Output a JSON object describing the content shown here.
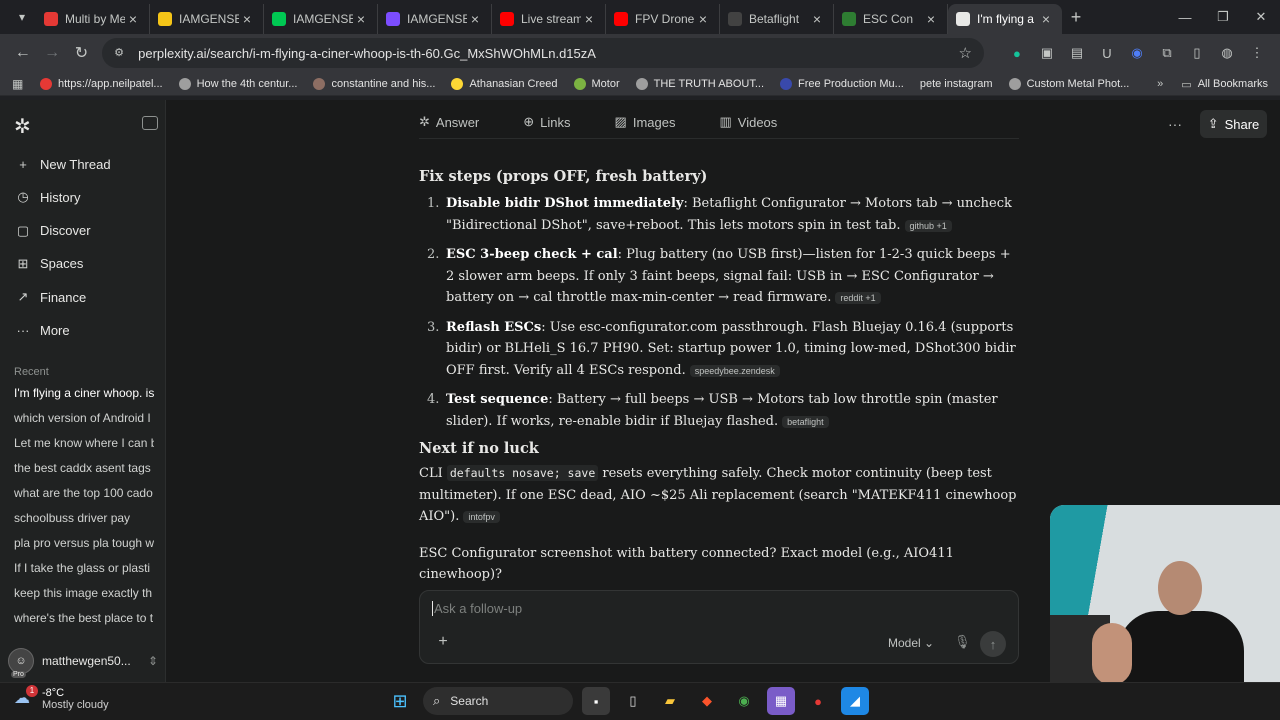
{
  "browser": {
    "tabs": [
      {
        "title": "Multi by Me",
        "color": "#e53935",
        "active": false
      },
      {
        "title": "IAMGENSER",
        "color": "#f5c518",
        "active": false
      },
      {
        "title": "IAMGENSER",
        "color": "#00c853",
        "active": false
      },
      {
        "title": "IAMGENSER",
        "color": "#7c4dff",
        "active": false
      },
      {
        "title": "Live streami",
        "color": "#ff0000",
        "active": false
      },
      {
        "title": "FPV Drone F",
        "color": "#ff0000",
        "active": false
      },
      {
        "title": "Betaflight",
        "color": "#424242",
        "active": false
      },
      {
        "title": "ESC Con",
        "color": "#2e7d32",
        "active": false
      },
      {
        "title": "I'm flying a",
        "color": "#e8e8e6",
        "active": true
      }
    ],
    "url": "perplexity.ai/search/i-m-flying-a-ciner-whoop-is-th-60.Gc_MxShWOhMLn.d15zA",
    "bookmarks": [
      {
        "label": "https://app.neilpatel...",
        "color": "#e53935"
      },
      {
        "label": "How the 4th centur...",
        "color": "#9e9e9e"
      },
      {
        "label": "constantine and his...",
        "color": "#8d6e63"
      },
      {
        "label": "Athanasian Creed",
        "color": "#fdd835"
      },
      {
        "label": "Motor",
        "color": "#7cb342"
      },
      {
        "label": "THE TRUTH ABOUT...",
        "color": "#9e9e9e"
      },
      {
        "label": "Free Production Mu...",
        "color": "#3949ab"
      },
      {
        "label": "pete instagram",
        "color": ""
      },
      {
        "label": "Custom Metal Phot...",
        "color": "#9e9e9e"
      }
    ],
    "all_bookmarks": "All Bookmarks"
  },
  "sidebar": {
    "nav": [
      {
        "label": "New Thread",
        "icon": "plus-icon"
      },
      {
        "label": "History",
        "icon": "history-icon"
      },
      {
        "label": "Discover",
        "icon": "discover-icon"
      },
      {
        "label": "Spaces",
        "icon": "spaces-icon"
      },
      {
        "label": "Finance",
        "icon": "finance-icon"
      },
      {
        "label": "More",
        "icon": "more-icon"
      }
    ],
    "recent_heading": "Recent",
    "recent": [
      "I'm flying a ciner whoop. is",
      "which version of Android I",
      "Let me know where I can b",
      "the best caddx asent tags",
      "what are the top 100 cado",
      "schoolbuss driver pay",
      "pla pro versus pla tough w",
      "If I take the glass or plasti",
      "keep this image exactly th",
      "where's the best place to t"
    ],
    "user": "matthewgen50...",
    "pro_badge": "Pro"
  },
  "topnav": {
    "tabs": [
      "Answer",
      "Links",
      "Images",
      "Videos"
    ],
    "share": "Share"
  },
  "answer": {
    "heading1": "Fix steps (props OFF, fresh battery)",
    "steps": [
      {
        "num": "1.",
        "bold": "Disable bidir DShot immediately",
        "text": ": Betaflight Configurator → Motors tab → uncheck \"Bidirectional DShot\", save+reboot. This lets motors spin in test tab.",
        "cite": "github +1"
      },
      {
        "num": "2.",
        "bold": "ESC 3-beep check + cal",
        "text": ": Plug battery (no USB first)—listen for 1-2-3 quick beeps + 2 slower arm beeps. If only 3 faint beeps, signal fail: USB in → ESC Configurator → battery on → cal throttle max-min-center → read firmware.",
        "cite": "reddit +1"
      },
      {
        "num": "3.",
        "bold": "Reflash ESCs",
        "text": ": Use esc-configurator.com passthrough. Flash Bluejay 0.16.4 (supports bidir) or BLHeli_S 16.7 PH90. Set: startup power 1.0, timing low-med, DShot300 bidir OFF first. Verify all 4 ESCs respond.",
        "cite": "speedybee.zendesk"
      },
      {
        "num": "4.",
        "bold": "Test sequence",
        "text": ": Battery → full beeps → USB → Motors tab low throttle spin (master slider). If works, re-enable bidir if Bluejay flashed.",
        "cite": "betaflight"
      }
    ],
    "heading2": "Next if no luck",
    "p1_prefix": "CLI ",
    "p1_code": "defaults nosave; save",
    "p1_text": " resets everything safely. Check motor continuity (beep test multimeter). If one ESC dead, AIO ~$25 Ali replacement (search \"MATEKF411 cinewhoop AIO\").",
    "p1_cite": "intofpv",
    "p2": "ESC Configurator screenshot with battery connected? Exact model (e.g., AIO411 cinewhoop)?"
  },
  "followup": {
    "placeholder": "Ask a follow-up",
    "model": "Model"
  },
  "taskbar": {
    "temp": "-8°C",
    "weather": "Mostly cloudy",
    "badge": "1",
    "search": "Search"
  }
}
